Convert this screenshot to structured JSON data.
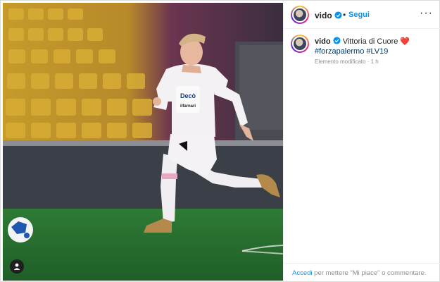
{
  "post": {
    "username": "vido",
    "follow_label": "Segui",
    "dot": "•",
    "more_icon": "more-horizontal-icon",
    "caption_text": "Vittoria di Cuore",
    "caption_emoji": "❤️",
    "hashtags": "#forzapalermo #LV19",
    "edited_label": "Elemento modificato",
    "time_ago": "1 h",
    "meta_separator": " · "
  },
  "footer": {
    "login_link": "Accedi",
    "login_suffix": "per mettere \"Mi piace\" o commentare."
  },
  "colors": {
    "accent": "#0095f6",
    "hashtag": "#00376b",
    "secondary_text": "#8e8e8e"
  }
}
